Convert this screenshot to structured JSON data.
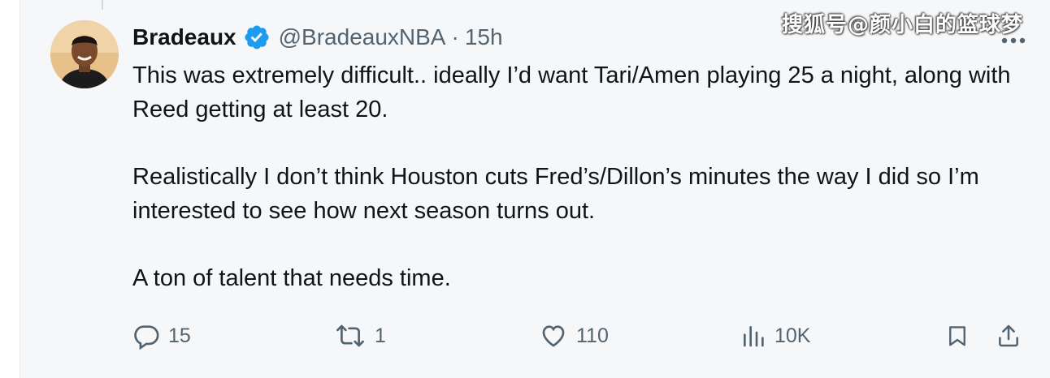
{
  "tweet": {
    "display_name": "Bradeaux",
    "handle": "@BradeauxNBA",
    "separator": "·",
    "time": "15h",
    "paragraphs": [
      "This was extremely difficult.. ideally I’d want Tari/Amen playing 25 a night, along with Reed getting at least 20.",
      "Realistically I don’t think Houston cuts Fred’s/Dillon’s minutes the way I did so I’m interested to see how next season turns out.",
      "A ton of talent that needs time."
    ]
  },
  "watermark": "搜狐号@颜小白的篮球梦",
  "actions": {
    "reply_count": "15",
    "retweet_count": "1",
    "like_count": "110",
    "views_count": "10K"
  },
  "colors": {
    "verified": "#1d9bf0",
    "muted": "#536471",
    "text": "#0f1419",
    "background": "#f6f7f9"
  },
  "icons": [
    "verified-badge-icon",
    "more-icon",
    "reply-icon",
    "retweet-icon",
    "like-icon",
    "views-icon",
    "bookmark-icon",
    "share-icon"
  ]
}
